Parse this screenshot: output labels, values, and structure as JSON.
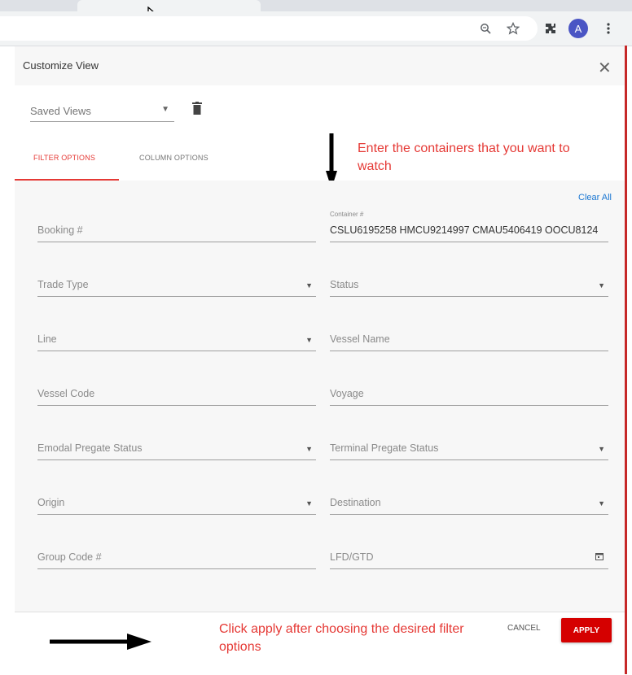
{
  "browser": {
    "toolbar_icons": [
      "zoom-icon",
      "star-icon",
      "extensions-icon",
      "avatar",
      "menu-icon"
    ],
    "avatar_letter": "A"
  },
  "dialog": {
    "title": "Customize View",
    "saved_views_label": "Saved Views",
    "tabs": [
      {
        "label": "FILTER OPTIONS",
        "active": true
      },
      {
        "label": "COLUMN OPTIONS",
        "active": false
      }
    ],
    "clear_all": "Clear All",
    "fields": {
      "booking": {
        "label": "Booking #"
      },
      "container": {
        "label": "Container #",
        "value": "CSLU6195258 HMCU9214997 CMAU5406419 OOCU8124"
      },
      "trade_type": {
        "label": "Trade Type"
      },
      "status": {
        "label": "Status"
      },
      "line": {
        "label": "Line"
      },
      "vessel_name": {
        "label": "Vessel Name"
      },
      "vessel_code": {
        "label": "Vessel Code"
      },
      "voyage": {
        "label": "Voyage"
      },
      "emodal_pregate": {
        "label": "Emodal Pregate Status"
      },
      "terminal_pregate": {
        "label": "Terminal Pregate Status"
      },
      "origin": {
        "label": "Origin"
      },
      "destination": {
        "label": "Destination"
      },
      "group_code": {
        "label": "Group Code #"
      },
      "lfd_gtd": {
        "label": "LFD/GTD"
      }
    },
    "cancel_label": "CANCEL",
    "apply_label": "APPLY"
  },
  "annotations": {
    "top": "Enter the containers that you want to watch",
    "bottom": "Click apply after choosing the desired filter options"
  },
  "colors": {
    "accent_red": "#e53935",
    "apply_red": "#d50000",
    "link_blue": "#1976d2"
  }
}
